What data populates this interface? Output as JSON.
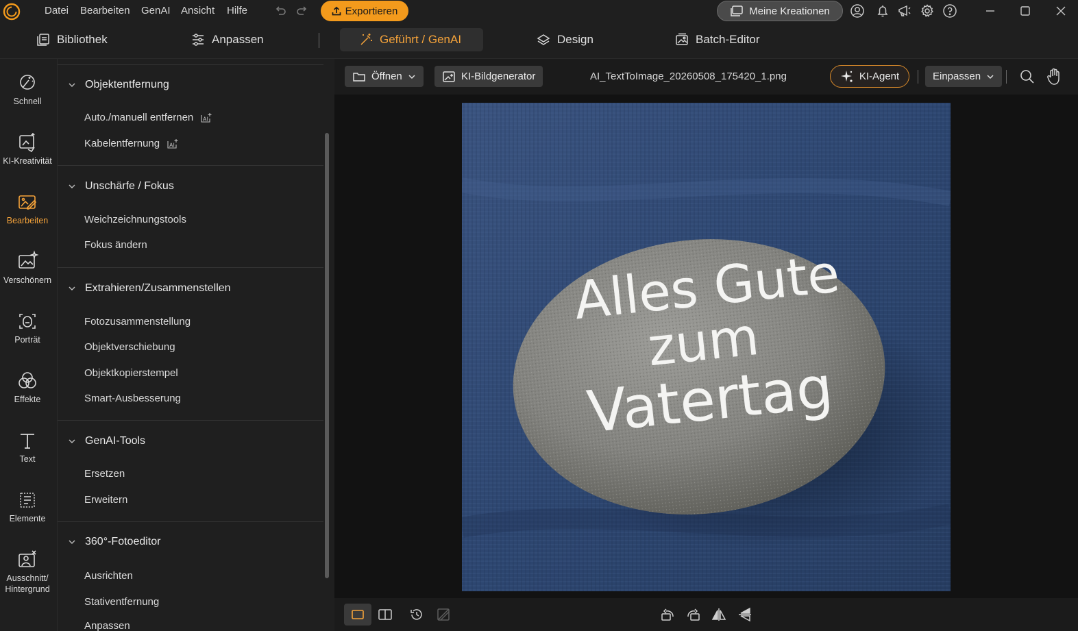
{
  "menu": [
    "Datei",
    "Bearbeiten",
    "GenAI",
    "Ansicht",
    "Hilfe"
  ],
  "toolbar": {
    "export_label": "Exportieren",
    "creations_label": "Meine Kreationen"
  },
  "modes": {
    "library": "Bibliothek",
    "adjust": "Anpassen",
    "guided": "Geführt / GenAI",
    "design": "Design",
    "batch": "Batch-Editor"
  },
  "rail": {
    "quick": "Schnell",
    "ai_creativity": "KI-Kreativität",
    "edit": "Bearbeiten",
    "beautify": "Verschönern",
    "portrait": "Porträt",
    "effects": "Effekte",
    "text": "Text",
    "elements": "Elemente",
    "cutout_line1": "Ausschnitt/",
    "cutout_line2": "Hintergrund"
  },
  "panel": {
    "sections": [
      {
        "title": "Objektentfernung",
        "tools": [
          "Auto./manuell entfernen",
          "Kabelentfernung"
        ]
      },
      {
        "title": "Unschärfe / Fokus",
        "tools": [
          "Weichzeichnungstools",
          "Fokus ändern"
        ]
      },
      {
        "title": "Extrahieren/Zusammenstellen",
        "tools": [
          "Fotozusammenstellung",
          "Objektverschiebung",
          "Objektkopierstempel",
          "Smart-Ausbesserung"
        ]
      },
      {
        "title": "GenAI-Tools",
        "tools": [
          "Ersetzen",
          "Erweitern"
        ]
      },
      {
        "title": "360°-Fotoeditor",
        "tools": [
          "Ausrichten",
          "Stativentfernung",
          "Anpassen"
        ]
      }
    ]
  },
  "canvas": {
    "open_label": "Öffnen",
    "generator_label": "KI-Bildgenerator",
    "file_name": "AI_TextToImage_20260508_175420_1.png",
    "agent_label": "KI-Agent",
    "fit_label": "Einpassen"
  },
  "photo": {
    "line1": "Alles Gute",
    "line2": "zum",
    "line3": "Vatertag"
  },
  "colors": {
    "accent": "#f39a1c",
    "active_tab": "#f5a33a",
    "panel_bg": "#1f1f1f",
    "canvas_bg": "#121212"
  }
}
